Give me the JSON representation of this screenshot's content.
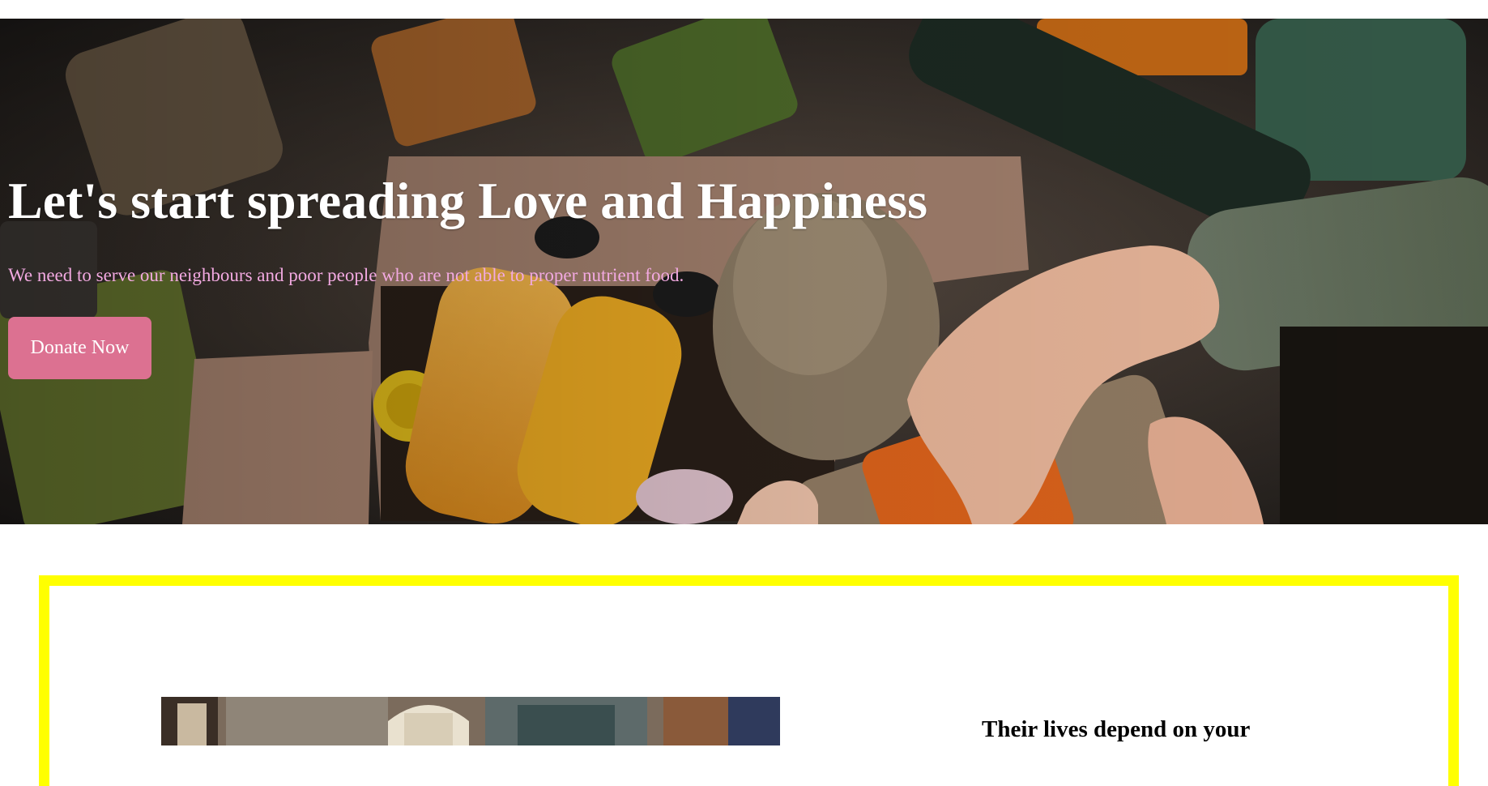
{
  "hero": {
    "title": "Let's start spreading Love and Happiness",
    "subtitle": "We need to serve our neighbours and poor people who are not able to proper nutrient food.",
    "donate_label": "Donate Now",
    "subtitle_color": "#f2a9e1",
    "button_color": "#dc7191"
  },
  "feature": {
    "border_color": "#ffff00",
    "heading": "Their lives depend on your"
  }
}
